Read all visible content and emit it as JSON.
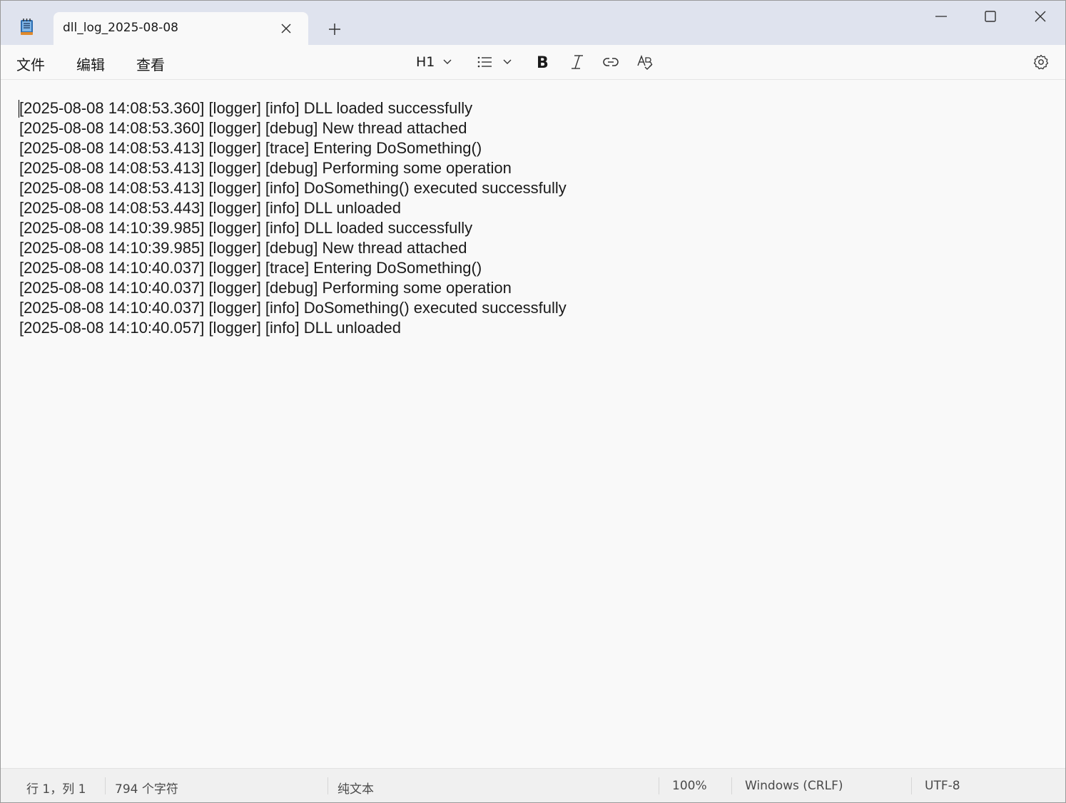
{
  "titlebar": {
    "tab_title": "dll_log_2025-08-08",
    "app_icon": "notepad-icon",
    "tab_close_icon": "close-icon",
    "new_tab_icon": "plus-icon",
    "minimize_icon": "minimize-icon",
    "maximize_icon": "maximize-icon",
    "close_icon": "close-icon"
  },
  "menubar": {
    "file": "文件",
    "edit": "编辑",
    "view": "查看"
  },
  "toolbar": {
    "heading": "H1",
    "icons": [
      "chevron-down-icon",
      "list-icon",
      "bold-icon",
      "italic-icon",
      "link-icon",
      "spellcheck-icon",
      "gear-icon"
    ]
  },
  "editor": {
    "lines": [
      "[2025-08-08 14:08:53.360] [logger] [info] DLL loaded successfully",
      "[2025-08-08 14:08:53.360] [logger] [debug] New thread attached",
      "[2025-08-08 14:08:53.413] [logger] [trace] Entering DoSomething()",
      "[2025-08-08 14:08:53.413] [logger] [debug] Performing some operation",
      "[2025-08-08 14:08:53.413] [logger] [info] DoSomething() executed successfully",
      "[2025-08-08 14:08:53.443] [logger] [info] DLL unloaded",
      "[2025-08-08 14:10:39.985] [logger] [info] DLL loaded successfully",
      "[2025-08-08 14:10:39.985] [logger] [debug] New thread attached",
      "[2025-08-08 14:10:40.037] [logger] [trace] Entering DoSomething()",
      "[2025-08-08 14:10:40.037] [logger] [debug] Performing some operation",
      "[2025-08-08 14:10:40.037] [logger] [info] DoSomething() executed successfully",
      "[2025-08-08 14:10:40.057] [logger] [info] DLL unloaded"
    ]
  },
  "statusbar": {
    "position": "行 1，列 1",
    "char_count": "794 个字符",
    "format": "纯文本",
    "zoom": "100%",
    "line_ending": "Windows (CRLF)",
    "encoding": "UTF-8"
  }
}
